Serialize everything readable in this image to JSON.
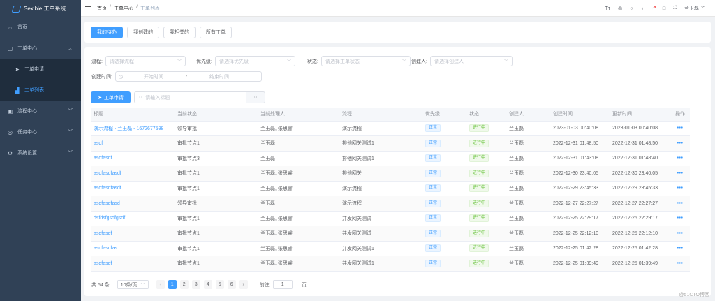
{
  "app": {
    "title": "Sexibie 工单系统"
  },
  "sidebar": {
    "items": [
      {
        "label": "首页",
        "icon": "home-icon"
      },
      {
        "label": "工单中心",
        "icon": "ticket-icon",
        "expanded": true
      },
      {
        "label": "工单申请",
        "icon": "send-icon",
        "sub": true
      },
      {
        "label": "工单列表",
        "icon": "bar-chart-icon",
        "sub": true,
        "active": true
      },
      {
        "label": "流程中心",
        "icon": "flow-icon"
      },
      {
        "label": "任务中心",
        "icon": "task-icon"
      },
      {
        "label": "系统设置",
        "icon": "gear-icon"
      }
    ]
  },
  "breadcrumb": [
    "首页",
    "工单中心",
    "工单列表"
  ],
  "header": {
    "user": "兰玉磊"
  },
  "tabs": [
    "我的待办",
    "我创建的",
    "我相关的",
    "所有工单"
  ],
  "filters": {
    "process_label": "流程:",
    "process_placeholder": "请选择流程",
    "priority_label": "优先级:",
    "priority_placeholder": "请选择优先级",
    "status_label": "状态:",
    "status_placeholder": "请选择工单状态",
    "creator_label": "创建人:",
    "creator_placeholder": "请选择创建人",
    "time_label": "创建时间:",
    "start_placeholder": "开始时间",
    "range_sep": "-",
    "end_placeholder": "结束时间"
  },
  "toolbar": {
    "new_label": "工单申请",
    "search_placeholder": "请输入标题"
  },
  "table": {
    "headers": [
      "标题",
      "当前状态",
      "当前处理人",
      "流程",
      "优先级",
      "状态",
      "创建人",
      "创建时间",
      "更新时间",
      "操作"
    ],
    "rows": [
      [
        "演示流程 - 兰玉磊 - 1672677598",
        "领导审批",
        "兰玉磊, 张思睿",
        "演示流程",
        "正常",
        "进行中",
        "兰玉磊",
        "2023-01-03 00:40:08",
        "2023-01-03 00:40:08"
      ],
      [
        "asdf",
        "审批节点1",
        "兰玉磊",
        "排他网关测试1",
        "正常",
        "进行中",
        "兰玉磊",
        "2022-12-31 01:48:50",
        "2022-12-31 01:48:50"
      ],
      [
        "asdfasdf",
        "审批节点3",
        "兰玉磊",
        "排他网关测试1",
        "正常",
        "进行中",
        "兰玉磊",
        "2022-12-31 01:43:08",
        "2022-12-31 01:48:40"
      ],
      [
        "asdfasdfasdf",
        "审批节点1",
        "兰玉磊, 张思睿",
        "排他网关",
        "正常",
        "进行中",
        "兰玉磊",
        "2022-12-30 23:40:05",
        "2022-12-30 23:40:05"
      ],
      [
        "asdfasdfasdf",
        "审批节点1",
        "兰玉磊, 张思睿",
        "演示流程",
        "正常",
        "进行中",
        "兰玉磊",
        "2022-12-29 23:45:33",
        "2022-12-29 23:45:33"
      ],
      [
        "asdfasdfasd",
        "领导审批",
        "兰玉磊",
        "演示流程",
        "正常",
        "进行中",
        "兰玉磊",
        "2022-12-27 22:27:27",
        "2022-12-27 22:27:27"
      ],
      [
        "dsfdsfgsdfgsdf",
        "审批节点1",
        "兰玉磊, 张思睿",
        "并发网关测试",
        "正常",
        "进行中",
        "兰玉磊",
        "2022-12-25 22:29:17",
        "2022-12-25 22:29:17"
      ],
      [
        "asdfasdf",
        "审批节点1",
        "兰玉磊, 张思睿",
        "并发网关测试",
        "正常",
        "进行中",
        "兰玉磊",
        "2022-12-25 22:12:10",
        "2022-12-25 22:12:10"
      ],
      [
        "asdfasdfas",
        "审批节点1",
        "兰玉磊, 张思睿",
        "并发网关测试1",
        "正常",
        "进行中",
        "兰玉磊",
        "2022-12-25 01:42:28",
        "2022-12-25 01:42:28"
      ],
      [
        "asdfasdf",
        "审批节点1",
        "兰玉磊, 张思睿",
        "并发网关测试1",
        "正常",
        "进行中",
        "兰玉磊",
        "2022-12-25 01:39:49",
        "2022-12-25 01:39:49"
      ]
    ]
  },
  "pagination": {
    "total": "共 54 条",
    "page_size": "10条/页",
    "pages": [
      "1",
      "2",
      "3",
      "4",
      "5",
      "6"
    ],
    "current": "1",
    "goto_label": "前往",
    "goto_value": "1",
    "goto_suffix": "页"
  },
  "watermark": "@51CTO博客",
  "colors": {
    "sidebar_bg": "#304156",
    "accent": "#409eff",
    "success": "#67c23a"
  }
}
